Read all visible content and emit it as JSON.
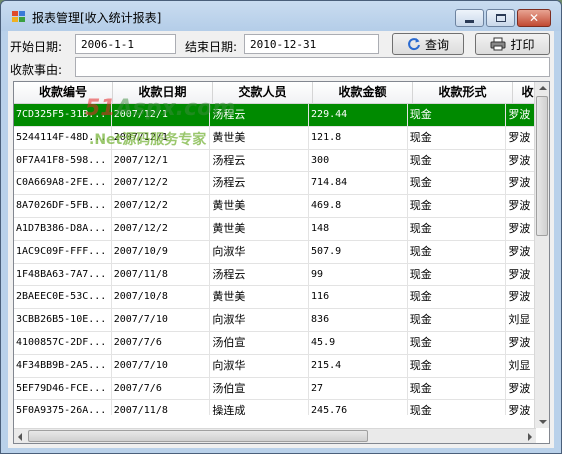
{
  "window": {
    "title": "报表管理[收入统计报表]"
  },
  "filters": {
    "start_label": "开始日期:",
    "start_value": "2006-1-1",
    "end_label": "结束日期:",
    "end_value": "2010-12-31",
    "reason_label": "收款事由:",
    "reason_value": ""
  },
  "buttons": {
    "query": "查询",
    "print": "打印"
  },
  "table": {
    "columns": [
      "收款编号",
      "收款日期",
      "交款人员",
      "收款金额",
      "收款形式",
      "收"
    ],
    "rows": [
      [
        "7CD325F5-31B...",
        "2007/12/1",
        "汤程云",
        "229.44",
        "现金",
        "罗波"
      ],
      [
        "5244114F-48D...",
        "2007/12/1",
        "黄世美",
        "121.8",
        "现金",
        "罗波"
      ],
      [
        "0F7A41F8-598...",
        "2007/12/1",
        "汤程云",
        "300",
        "现金",
        "罗波"
      ],
      [
        "C0A669A8-2FE...",
        "2007/12/2",
        "汤程云",
        "714.84",
        "现金",
        "罗波"
      ],
      [
        "8A7026DF-5FB...",
        "2007/12/2",
        "黄世美",
        "469.8",
        "现金",
        "罗波"
      ],
      [
        "A1D7B386-D8A...",
        "2007/12/2",
        "黄世美",
        "148",
        "现金",
        "罗波"
      ],
      [
        "1AC9C09F-FFF...",
        "2007/10/9",
        "向淑华",
        "507.9",
        "现金",
        "罗波"
      ],
      [
        "1F48BA63-7A7...",
        "2007/11/8",
        "汤程云",
        "99",
        "现金",
        "罗波"
      ],
      [
        "2BAEEC0E-53C...",
        "2007/10/8",
        "黄世美",
        "116",
        "现金",
        "罗波"
      ],
      [
        "3CBB26B5-10E...",
        "2007/7/10",
        "向淑华",
        "836",
        "现金",
        "刘显"
      ],
      [
        "4100857C-2DF...",
        "2007/7/6",
        "汤伯宣",
        "45.9",
        "现金",
        "罗波"
      ],
      [
        "4F34BB9B-2A5...",
        "2007/7/10",
        "向淑华",
        "215.4",
        "现金",
        "刘显"
      ],
      [
        "5EF79D46-FCE...",
        "2007/7/6",
        "汤伯宣",
        "27",
        "现金",
        "罗波"
      ],
      [
        "5F0A9375-26A...",
        "2007/11/8",
        "操连成",
        "245.76",
        "现金",
        "罗波"
      ]
    ],
    "selected_row": 0
  },
  "watermark": {
    "site_prefix": "51",
    "site_rest": "Aspx.com",
    "slogan": ".Net源码服务专家"
  },
  "colors": {
    "selection": "#008a00",
    "window_frame": "#b9d1ea"
  }
}
